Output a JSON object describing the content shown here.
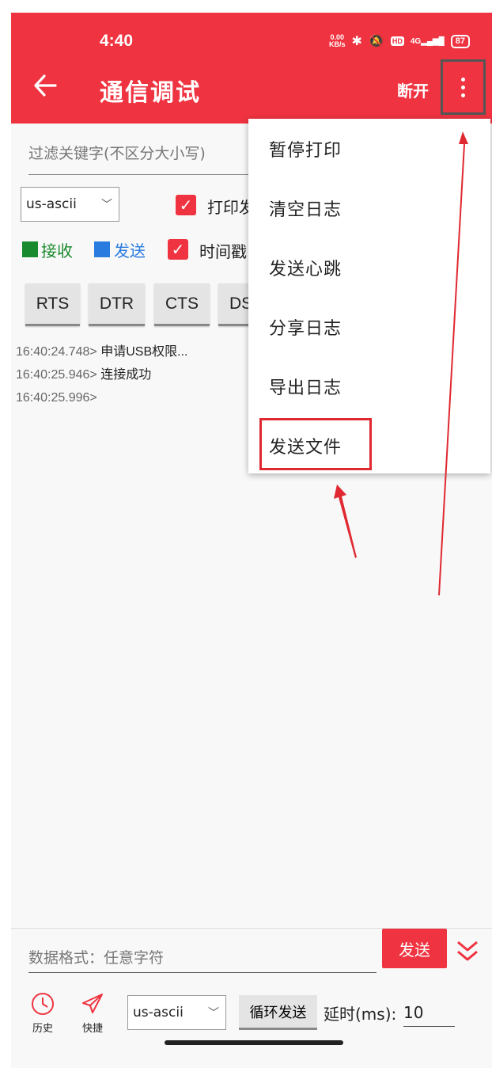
{
  "status_bar": {
    "time": "4:40",
    "net_speed_top": "0.00",
    "net_speed_bottom": "KB/s",
    "hd": "HD",
    "signal": "4G",
    "battery": "87"
  },
  "appbar": {
    "title": "通信调试",
    "disconnect": "断开"
  },
  "filter": {
    "placeholder": "过滤关键字(不区分大小写)"
  },
  "encoding": {
    "value": "us-ascii"
  },
  "print_checkbox": {
    "label": "打印发"
  },
  "legend": {
    "receive": "接收",
    "send": "发送",
    "timestamp": "时间戳",
    "receive_color": "#1a8a2e",
    "send_color": "#2a7be0"
  },
  "control_buttons": [
    "RTS",
    "DTR",
    "CTS",
    "DS"
  ],
  "log": [
    {
      "time": "16:40:24.748>",
      "text": "申请USB权限..."
    },
    {
      "time": "16:40:25.946>",
      "text": "连接成功"
    },
    {
      "time": "16:40:25.996>",
      "text": ""
    }
  ],
  "menu": {
    "items": [
      "暂停打印",
      "清空日志",
      "发送心跳",
      "分享日志",
      "导出日志",
      "发送文件"
    ]
  },
  "bottom": {
    "data_placeholder": "数据格式：任意字符",
    "send": "发送",
    "history": "历史",
    "shortcut": "快捷",
    "encoding": "us-ascii",
    "loop_send": "循环发送",
    "delay_label": "延时(ms):",
    "delay_value": "10"
  },
  "colors": {
    "accent": "#ef3340",
    "highlight": "#e02830"
  }
}
